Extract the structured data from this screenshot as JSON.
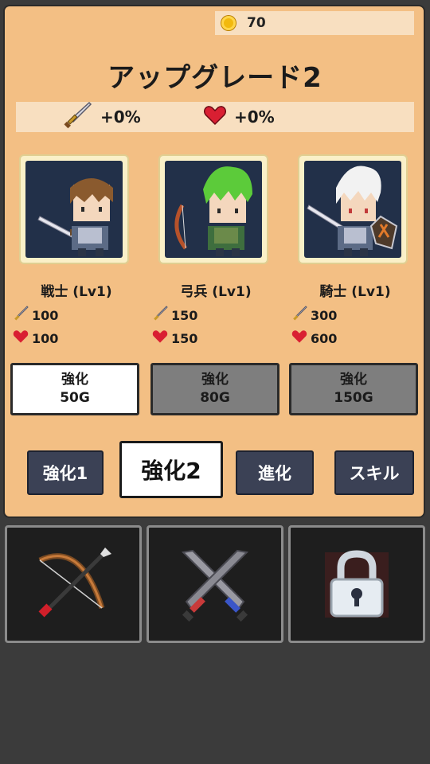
{
  "header": {
    "gold": "70",
    "title": "アップグレード2"
  },
  "bonuses": {
    "attack": "+0%",
    "hp": "+0%"
  },
  "units": [
    {
      "name": "戦士 (Lv1)",
      "attack": "100",
      "hp": "100",
      "upgrade_label": "強化",
      "cost": "50G",
      "selected": true
    },
    {
      "name": "弓兵 (Lv1)",
      "attack": "150",
      "hp": "150",
      "upgrade_label": "強化",
      "cost": "80G",
      "selected": false
    },
    {
      "name": "騎士 (Lv1)",
      "attack": "300",
      "hp": "600",
      "upgrade_label": "強化",
      "cost": "150G",
      "selected": false
    }
  ],
  "tabs": [
    {
      "label": "強化1",
      "active": false
    },
    {
      "label": "強化2",
      "active": true
    },
    {
      "label": "進化",
      "active": false
    },
    {
      "label": "スキル",
      "active": false
    }
  ],
  "bottom_nav": [
    {
      "icon": "bow-arrow-icon"
    },
    {
      "icon": "crossed-swords-icon"
    },
    {
      "icon": "lock-icon"
    }
  ],
  "colors": {
    "panel": "#f3bf84",
    "strip": "#f8dfc0",
    "portrait_bg": "#223049",
    "tab": "#3b4155"
  }
}
